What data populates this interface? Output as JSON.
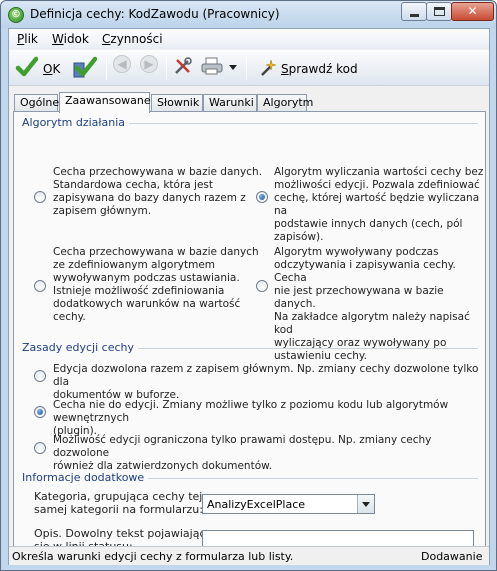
{
  "window": {
    "title": "Definicja cechy: KodZawodu (Pracownicy)",
    "app_icon_glyph": "©"
  },
  "menu": {
    "items": [
      {
        "label": "Plik",
        "mnemonic": "P",
        "rest": "lik"
      },
      {
        "label": "Widok",
        "mnemonic": "W",
        "rest": "idok"
      },
      {
        "label": "Czynności",
        "mnemonic": "C",
        "rest": "zynności"
      }
    ]
  },
  "toolbar": {
    "ok_mnemonic": "O",
    "ok_rest": "K",
    "check_label_mnemonic": "S",
    "check_label_rest": "prawdź kod",
    "icons": [
      "ok-check-icon",
      "apply-check-icon",
      "back-arrow-icon",
      "forward-arrow-icon",
      "tools-icon",
      "print-icon",
      "dropdown-arrow-icon",
      "magic-wand-icon"
    ]
  },
  "tabs": [
    {
      "label": "Ogólne",
      "active": false
    },
    {
      "label": "Zaawansowane",
      "active": true
    },
    {
      "label": "Słownik",
      "active": false
    },
    {
      "label": "Warunki",
      "active": false
    },
    {
      "label": "Algorytm",
      "active": false
    }
  ],
  "algorithm": {
    "title": "Algorytm działania",
    "options": [
      {
        "lines": [
          "Cecha przechowywana w bazie danych.",
          "Standardowa cecha, która jest",
          "zapisywana do bazy danych razem z",
          "zapisem głównym."
        ],
        "checked": false
      },
      {
        "lines": [
          "Algorytm wyliczania wartości cechy bez",
          "możliwości edycji. Pozwala zdefiniować",
          "cechę, której wartość będzie wyliczana na",
          "podstawie innych danych (cech, pól",
          "zapisów)."
        ],
        "checked": true
      },
      {
        "lines": [
          "Cecha przechowywana w bazie danych",
          "ze zdefiniowanym algorytmem",
          "wywoływanym podczas ustawiania.",
          "Istnieje możliwość zdefiniowania",
          "dodatkowych warunków na wartość",
          "cechy."
        ],
        "checked": false
      },
      {
        "lines": [
          "Algorytm wywoływany podczas",
          "odczytywania i zapisywania cechy. Cecha",
          "nie jest przechowywana w bazie danych.",
          "Na zakładce algorytm należy napisać kod",
          "wyliczający oraz wywoływany po",
          "ustawieniu cechy."
        ],
        "checked": false
      }
    ]
  },
  "editing": {
    "title": "Zasady edycji cechy",
    "options": [
      {
        "lines": [
          "Edycja dozwolona razem z zapisem głównym. Np. zmiany cechy dozwolone tylko dla",
          "dokumentów w buforze."
        ],
        "checked": false
      },
      {
        "lines": [
          "Cecha nie do edycji. Zmiany możliwe tylko z poziomu kodu lub algorytmów wewnętrznych",
          "(plugin)."
        ],
        "checked": true
      },
      {
        "lines": [
          "Możliwość edycji ograniczona tylko prawami dostępu. Np. zmiany cechy dozwolone",
          "również dla zatwierdzonych dokumentów."
        ],
        "checked": false
      }
    ]
  },
  "additional": {
    "title": "Informacje dodatkowe",
    "category_label_lines": [
      "Kategoria, grupująca cechy tej",
      "samej kategorii na formularzu:"
    ],
    "category_value": "AnalizyExcelPlace",
    "description_label_lines": [
      "Opis. Dowolny tekst pojawiający",
      "się w linii statusu:"
    ],
    "description_value": ""
  },
  "status": {
    "left": "Określa warunki edycji cechy z formularza lub listy.",
    "right": "Dodawanie"
  }
}
